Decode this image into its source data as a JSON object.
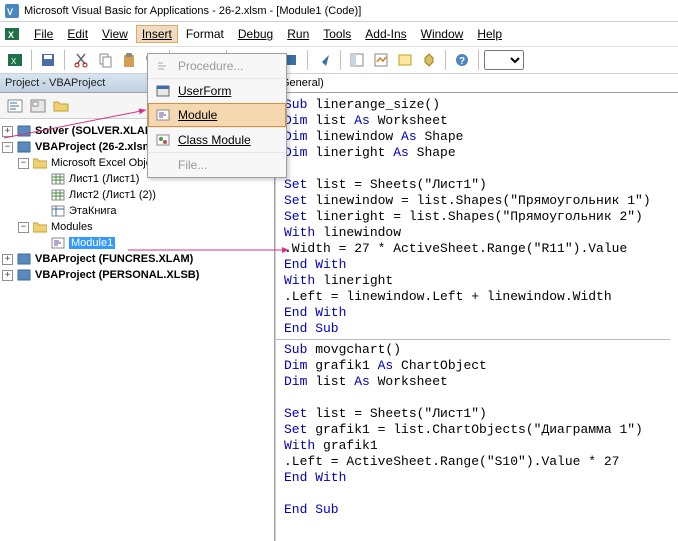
{
  "titlebar": {
    "title": "Microsoft Visual Basic for Applications - 26-2.xlsm - [Module1 (Code)]"
  },
  "menu": {
    "file": "File",
    "edit": "Edit",
    "view": "View",
    "insert": "Insert",
    "format": "Format",
    "debug": "Debug",
    "run": "Run",
    "tools": "Tools",
    "addins": "Add-Ins",
    "window": "Window",
    "help": "Help"
  },
  "dropdown": {
    "procedure": "Procedure...",
    "userform": "UserForm",
    "module": "Module",
    "classmodule": "Class Module",
    "file": "File..."
  },
  "project_panel_title": "Project - VBAProject",
  "tree": {
    "solver": "Solver (SOLVER.XLAM)",
    "vba_main": "VBAProject (26-2.xlsm)",
    "excel_objects": "Microsoft Excel Objects",
    "sheet1": "Лист1 (Лист1)",
    "sheet2": "Лист2 (Лист1 (2))",
    "thisworkbook": "ЭтаКнига",
    "modules": "Modules",
    "module1": "Module1",
    "funcres": "VBAProject (FUNCRES.XLAM)",
    "personal": "VBAProject (PERSONAL.XLSB)"
  },
  "code_header": "General)",
  "code": {
    "l1a": "Sub",
    "l1b": " linerange_size()",
    "l2a": "Dim",
    "l2b": " list ",
    "l2c": "As",
    "l2d": " Worksheet",
    "l3a": "Dim",
    "l3b": " linewindow ",
    "l3c": "As",
    "l3d": " Shape",
    "l4a": "Dim",
    "l4b": " lineright ",
    "l4c": "As",
    "l4d": " Shape",
    "l6a": "Set",
    "l6b": " list = Sheets(\"Лист1\")",
    "l7a": "Set",
    "l7b": " linewindow = list.Shapes(\"Прямоугольник 1\")",
    "l8a": "Set",
    "l8b": " lineright = list.Shapes(\"Прямоугольник 2\")",
    "l9a": "With",
    "l9b": " linewindow",
    "l10": ".Width = 27 * ActiveSheet.Range(\"R11\").Value",
    "l11": "End With",
    "l12a": "With",
    "l12b": " lineright",
    "l13": ".Left = linewindow.Left + linewindow.Width",
    "l14": "End With",
    "l15": "End Sub",
    "l17a": "Sub",
    "l17b": " movgchart()",
    "l18a": "Dim",
    "l18b": " grafik1 ",
    "l18c": "As",
    "l18d": " ChartObject",
    "l19a": "Dim",
    "l19b": " list ",
    "l19c": "As",
    "l19d": " Worksheet",
    "l21a": "Set",
    "l21b": " list = Sheets(\"Лист1\")",
    "l22a": "Set",
    "l22b": " grafik1 = list.ChartObjects(\"Диаграмма 1\")",
    "l23a": "With",
    "l23b": " grafik1",
    "l24": ".Left = ActiveSheet.Range(\"S10\").Value * 27",
    "l25": "End With",
    "l27": "End Sub"
  }
}
